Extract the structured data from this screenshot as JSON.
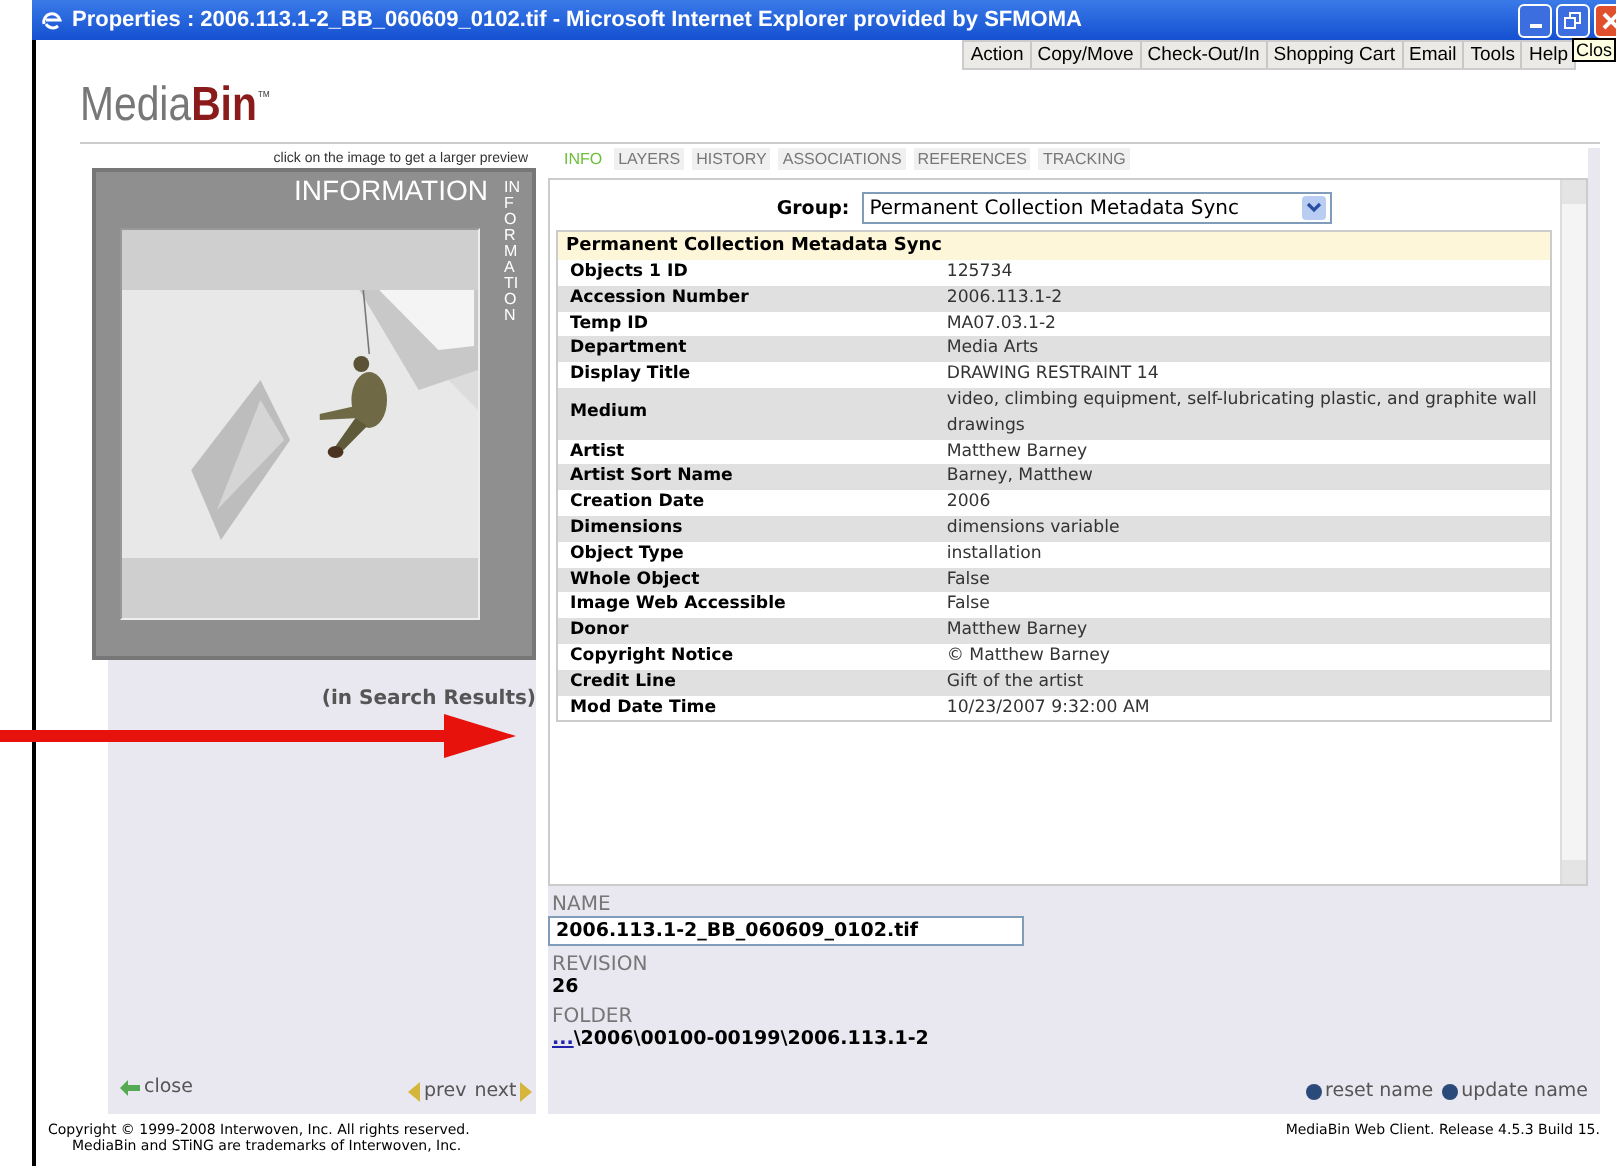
{
  "window": {
    "title": "Properties : 2006.113.1-2_BB_060609_0102.tif - Microsoft Internet Explorer provided by SFMOMA",
    "tooltip": "Clos"
  },
  "menu": [
    "Action",
    "Copy/Move",
    "Check-Out/In",
    "Shopping Cart",
    "Email",
    "Tools",
    "Help"
  ],
  "logo": {
    "light": "Media",
    "bold": "Bin",
    "mark": "™"
  },
  "preview": {
    "hint": "click on the image to get a larger preview",
    "title": "INFORMATION",
    "side_label": "INFORMATION",
    "caption": "(in Search Results)"
  },
  "tabs": [
    {
      "label": "INFO",
      "selected": true
    },
    {
      "label": "LAYERS",
      "selected": false
    },
    {
      "label": "HISTORY",
      "selected": false
    },
    {
      "label": "ASSOCIATIONS",
      "selected": false
    },
    {
      "label": "REFERENCES",
      "selected": false
    },
    {
      "label": "TRACKING",
      "selected": false
    }
  ],
  "group": {
    "label": "Group:",
    "value": "Permanent Collection Metadata Sync"
  },
  "table": {
    "title": "Permanent Collection Metadata Sync",
    "rows": [
      {
        "label": "Objects 1 ID",
        "value": "125734"
      },
      {
        "label": "Accession Number",
        "value": "2006.113.1-2"
      },
      {
        "label": "Temp ID",
        "value": "MA07.03.1-2"
      },
      {
        "label": "Department",
        "value": "Media Arts"
      },
      {
        "label": "Display Title",
        "value": "DRAWING RESTRAINT 14"
      },
      {
        "label": "Medium",
        "value": "video, climbing equipment, self-lubricating plastic, and graphite wall drawings"
      },
      {
        "label": "Artist",
        "value": "Matthew Barney"
      },
      {
        "label": "Artist Sort Name",
        "value": "Barney, Matthew"
      },
      {
        "label": "Creation Date",
        "value": "2006"
      },
      {
        "label": "Dimensions",
        "value": "dimensions variable"
      },
      {
        "label": "Object Type",
        "value": "installation"
      },
      {
        "label": "Whole Object",
        "value": "False"
      },
      {
        "label": "Image Web Accessible",
        "value": "False"
      },
      {
        "label": "Donor",
        "value": "Matthew Barney"
      },
      {
        "label": "Copyright Notice",
        "value": "© Matthew Barney"
      },
      {
        "label": "Credit Line",
        "value": "Gift of the artist"
      },
      {
        "label": "Mod Date Time",
        "value": "10/23/2007 9:32:00 AM"
      }
    ]
  },
  "name": {
    "label": "NAME",
    "value": "2006.113.1-2_BB_060609_0102.tif"
  },
  "revision": {
    "label": "REVISION",
    "value": "26"
  },
  "folder": {
    "label": "FOLDER",
    "link": "...",
    "path": "\\2006\\00100-00199\\2006.113.1-2"
  },
  "nav": {
    "close": "close",
    "prev": "prev",
    "next": "next",
    "reset": "reset name",
    "update": "update name"
  },
  "footer": {
    "copyright": "Copyright © 1999-2008 Interwoven, Inc. All rights reserved.",
    "trademark": "MediaBin and STiNG are trademarks of Interwoven, Inc.",
    "version": "MediaBin Web Client. Release 4.5.3 Build 15."
  }
}
